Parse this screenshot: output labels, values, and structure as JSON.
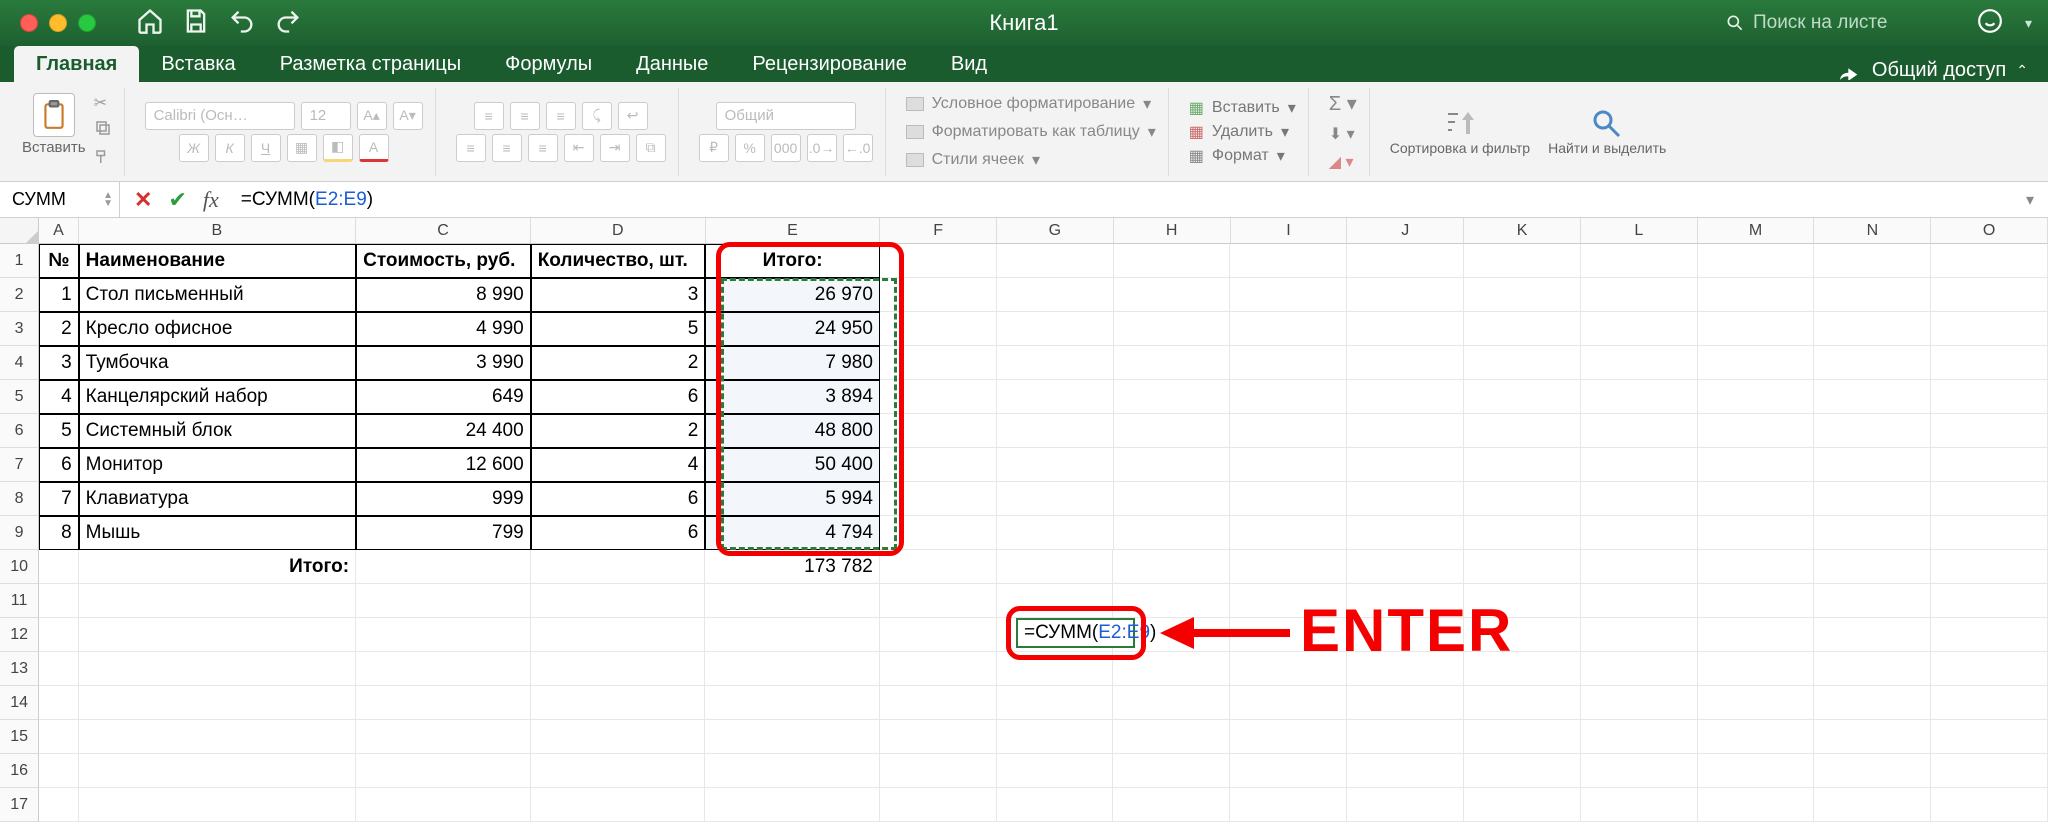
{
  "title": "Книга1",
  "search_placeholder": "Поиск на листе",
  "tabs": [
    "Главная",
    "Вставка",
    "Разметка страницы",
    "Формулы",
    "Данные",
    "Рецензирование",
    "Вид"
  ],
  "share": "Общий доступ",
  "ribbon": {
    "paste": "Вставить",
    "font_name": "Calibri (Осн…",
    "font_size": "12",
    "number_format": "Общий",
    "cond_format": "Условное форматирование",
    "as_table": "Форматировать как таблицу",
    "cell_styles": "Стили ячеек",
    "insert": "Вставить",
    "delete": "Удалить",
    "format": "Формат",
    "sort": "Сортировка и фильтр",
    "find": "Найти и выделить"
  },
  "fbar": {
    "name": "СУММ",
    "formula_prefix": "=СУММ(",
    "formula_ref": "E2:E9",
    "formula_suffix": ")"
  },
  "cols": [
    "A",
    "B",
    "C",
    "D",
    "E",
    "F",
    "G",
    "H",
    "I",
    "J",
    "K",
    "L",
    "M",
    "N",
    "O"
  ],
  "hdr": {
    "A": "№",
    "B": "Наименование",
    "C": "Стоимость, руб.",
    "D": "Количество, шт.",
    "E": "Итого:"
  },
  "rows": [
    {
      "n": "1",
      "name": "Стол письменный",
      "cost": "8 990",
      "qty": "3",
      "total": "26 970"
    },
    {
      "n": "2",
      "name": "Кресло офисное",
      "cost": "4 990",
      "qty": "5",
      "total": "24 950"
    },
    {
      "n": "3",
      "name": "Тумбочка",
      "cost": "3 990",
      "qty": "2",
      "total": "7 980"
    },
    {
      "n": "4",
      "name": "Канцелярский набор",
      "cost": "649",
      "qty": "6",
      "total": "3 894"
    },
    {
      "n": "5",
      "name": "Системный блок",
      "cost": "24 400",
      "qty": "2",
      "total": "48 800"
    },
    {
      "n": "6",
      "name": "Монитор",
      "cost": "12 600",
      "qty": "4",
      "total": "50 400"
    },
    {
      "n": "7",
      "name": "Клавиатура",
      "cost": "999",
      "qty": "6",
      "total": "5 994"
    },
    {
      "n": "8",
      "name": "Мышь",
      "cost": "799",
      "qty": "6",
      "total": "4 794"
    }
  ],
  "footer": {
    "label": "Итого:",
    "grand": "173 782"
  },
  "editing": {
    "prefix": "=СУММ(",
    "ref": "E2:E9",
    "suffix": ")"
  },
  "annotation": "ENTER"
}
